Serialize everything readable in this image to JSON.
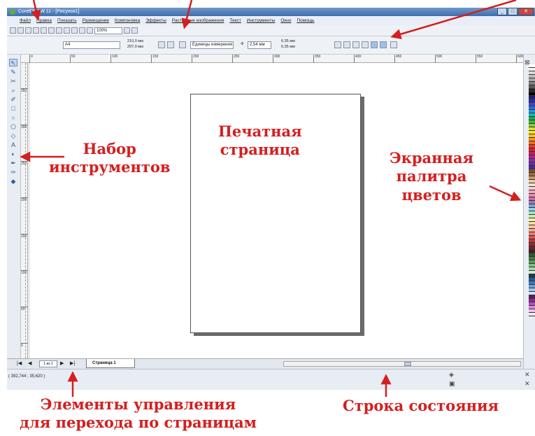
{
  "window": {
    "title": "CorelDRAW 11 - [Рисунок1]",
    "buttons": [
      "_",
      "□",
      "✕"
    ]
  },
  "menu": [
    "Файл",
    "Правка",
    "Показать",
    "Размещение",
    "Компоновка",
    "Эффекты",
    "Растровые изображения",
    "Текст",
    "Инструменты",
    "Окно",
    "Помощь"
  ],
  "toolbar": {
    "zoom": "100%",
    "icon_names": [
      "new-icon",
      "open-icon",
      "save-icon",
      "print-icon",
      "cut-icon",
      "copy-icon",
      "paste-icon",
      "undo-icon",
      "redo-icon",
      "import-icon",
      "export-icon"
    ]
  },
  "property_bar": {
    "paper": "A4",
    "width": "210,0 мм",
    "height": "297,0 мм",
    "units": "Единицы измерения",
    "nudge": "2,54 мм",
    "dup_x": "6,35 мм",
    "dup_y": "6,35 мм"
  },
  "ruler": {
    "top_labels": [
      "0",
      "50",
      "100",
      "150",
      "200",
      "250",
      "300",
      "350",
      "400",
      "450",
      "500",
      "550",
      "600"
    ],
    "left_labels": [
      "350",
      "300",
      "250",
      "200",
      "150",
      "100",
      "50",
      "0"
    ]
  },
  "page_navigation": {
    "page_count": "1 из 1",
    "page_tab": "Страница 1"
  },
  "status": {
    "coordinates": "( 392,744 ; 35,620 )"
  },
  "callouts": {
    "page": "Печатная\nстраница",
    "toolbox": "Набор\nинструментов",
    "palette": "Экранная\nпалитра\nцветов",
    "nav": "Элементы управления\nдля перехода по страницам",
    "statusbar": "Строка состояния"
  },
  "colors": {
    "callout": "#d41f1f",
    "palette": [
      "#ffffff",
      "#f2f2f2",
      "#d9d9d9",
      "#bfbfbf",
      "#a6a6a6",
      "#808080",
      "#595959",
      "#262626",
      "#000000",
      "#1e1e6e",
      "#2b2b9b",
      "#3d49c9",
      "#2b6cd6",
      "#1a9bd8",
      "#19b7b0",
      "#1aa85a",
      "#3db82e",
      "#8ec63f",
      "#d6e33a",
      "#f5e61e",
      "#f7c21a",
      "#f49a1a",
      "#ef6b1d",
      "#e53a1f",
      "#d21f2c",
      "#c21d5a",
      "#b21f86",
      "#8f2a9e",
      "#6a2d9d",
      "#4b2b8c",
      "#7b4f2e",
      "#a06a3a",
      "#c89766",
      "#e8c9a0",
      "#f5e3c7",
      "#f7d2d2",
      "#f4a6b7",
      "#e98ab0",
      "#c86ca2",
      "#9a7ab8",
      "#7ea0d6",
      "#8fd0e8",
      "#a9e2c8",
      "#cfe8a9",
      "#f3f0a9",
      "#f8dca0",
      "#f7c4a0",
      "#f2a58e",
      "#e77f6e",
      "#d6564d",
      "#b8373a",
      "#8e2a2c",
      "#6b2222",
      "#4a1a1a",
      "#2e5a2e",
      "#3f7a3f",
      "#5a9a5a",
      "#7fbf7f",
      "#a6d9a6",
      "#d0ecd0",
      "#1a3a5a",
      "#2a5a8a",
      "#3a7aba",
      "#6aa0d8",
      "#a0c6ec",
      "#d0e4f6",
      "#5a1a5a",
      "#8a2a8a",
      "#ba4aba",
      "#d88ad8",
      "#ecc0ec",
      "#f8e8f8"
    ]
  }
}
